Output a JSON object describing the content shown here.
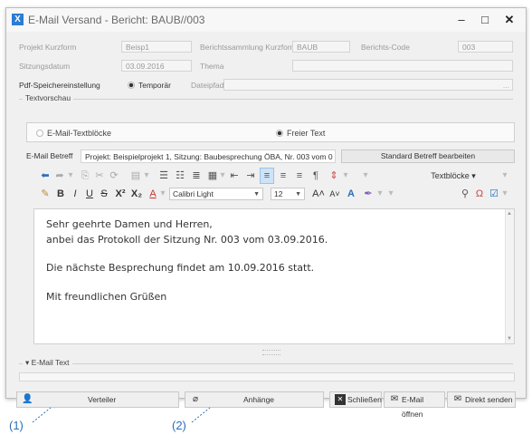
{
  "window": {
    "icon_letter": "X",
    "title": "E-Mail Versand - Bericht: BAUB//003",
    "controls": [
      "‒",
      "□",
      "✕"
    ]
  },
  "fields": {
    "projekt_label": "Projekt Kurzform",
    "projekt_value": "Beisp1",
    "berichtssammlung_label": "Berichtssammlung Kurzform",
    "berichtssammlung_value": "BAUB",
    "berichts_code_label": "Berichts-Code",
    "berichts_code_value": "003",
    "sitzungsdatum_label": "Sitzungsdatum",
    "sitzungsdatum_value": "03.09.2016",
    "thema_label": "Thema",
    "thema_value": "",
    "pdf_label": "Pdf-Speichereinstellung",
    "pdf_option": "Temporär",
    "dateipfad_label": "Dateipfad",
    "dateipfad_button": "..."
  },
  "textvorschau": {
    "group_title": "Textvorschau",
    "radio_textbloecke": "E-Mail-Textblöcke",
    "radio_freier_text": "Freier Text",
    "selected": "Freier Text",
    "betreff_label": "E-Mail Betreff",
    "betreff_value": "Projekt: Beispielprojekt 1, Sitzung: Baubesprechung ÖBA, Nr. 003 vom 0",
    "betreff_button": "Standard Betreff bearbeiten"
  },
  "toolbar": {
    "textbloecke_label": "Textblöcke",
    "font_name": "Calibri Light",
    "font_size": "12",
    "bold": "B",
    "italic": "I",
    "underline": "U",
    "strike": "S",
    "superscript": "X²",
    "subscript": "X₂",
    "font_color": "A",
    "grow": "A˄",
    "shrink": "A˅",
    "case": "A",
    "paragraph": "¶"
  },
  "editor": {
    "lines": [
      "Sehr geehrte Damen und Herren,",
      "anbei das Protokoll der Sitzung Nr. 003 vom 03.09.2016.",
      "Die nächste Besprechung findet am 10.09.2016 statt.",
      "Mit freundlichen Grüßen"
    ]
  },
  "email_text": {
    "group_title": "E-Mail Text"
  },
  "footer": {
    "verteiler": "Verteiler",
    "anhaenge": "Anhänge",
    "schliessen": "Schließen",
    "email_oeffnen": "E-Mail öffnen",
    "direkt_senden": "Direkt senden"
  },
  "callouts": {
    "one": "(1)",
    "two": "(2)"
  },
  "colors": {
    "accent": "#2b7cd3",
    "callout": "#2a6ebb",
    "selection": "#cfe3f7"
  }
}
